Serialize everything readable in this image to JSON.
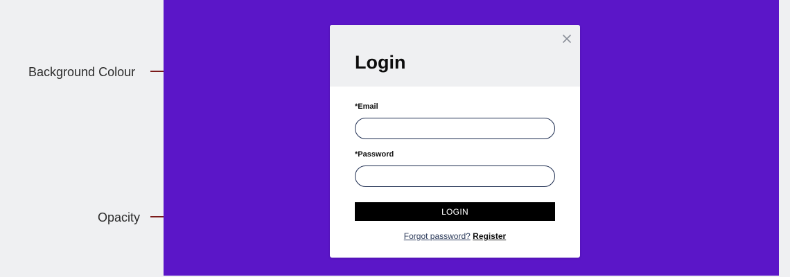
{
  "annotations": {
    "background_label": "Background Colour",
    "opacity_label": "Opacity",
    "line_color": "#7a1a1a"
  },
  "backdrop": {
    "color": "#5b16c8"
  },
  "modal": {
    "title": "Login",
    "close_icon": "close-icon",
    "email": {
      "label": "*Email",
      "value": "",
      "placeholder": ""
    },
    "password": {
      "label": "*Password",
      "value": "",
      "placeholder": ""
    },
    "login_button": "LOGIN",
    "forgot_password": "Forgot password?",
    "register": "Register",
    "header_color": "#eff0f2",
    "input_border_color": "#1b2a4e",
    "button_color": "#000000"
  }
}
